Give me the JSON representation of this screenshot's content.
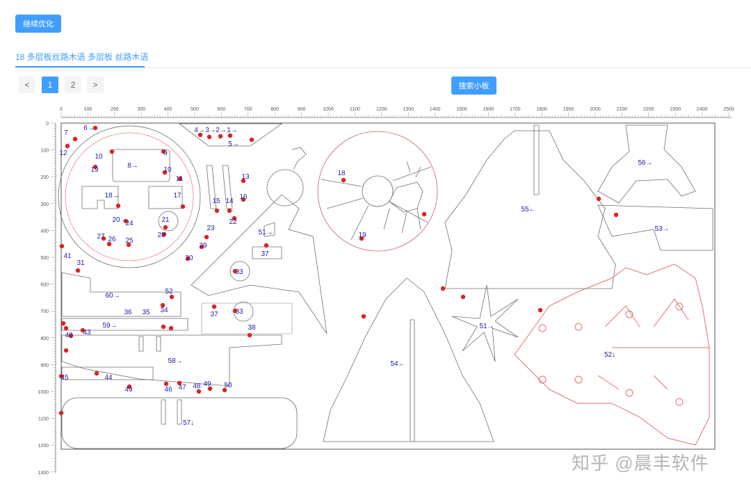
{
  "toolbar": {
    "continue_label": "继续优化",
    "search_label": "搜索小板"
  },
  "tab": {
    "title": "18 多层板丝路木语 多层板 丝路木语"
  },
  "pagination": {
    "prev": "<",
    "next": ">",
    "pages": [
      "1",
      "2"
    ],
    "current": "1"
  },
  "ruler": {
    "x_ticks": [
      "0",
      "100",
      "200",
      "300",
      "400",
      "500",
      "600",
      "700",
      "800",
      "900",
      "1000",
      "1100",
      "1200",
      "1300",
      "1400",
      "1500",
      "1600",
      "1700",
      "1800",
      "1900",
      "2000",
      "2100",
      "2200",
      "2300",
      "2400",
      "2500"
    ],
    "y_ticks": [
      "0",
      "100",
      "200",
      "300",
      "400",
      "500",
      "600",
      "700",
      "800",
      "900",
      "1000",
      "1100",
      "1200",
      "1300"
    ]
  },
  "parts": [
    {
      "label": "7",
      "x": 95,
      "y": 190
    },
    {
      "label": "6→",
      "x": 128,
      "y": 183
    },
    {
      "label": "4→",
      "x": 287,
      "y": 186
    },
    {
      "label": "3→",
      "x": 303,
      "y": 186
    },
    {
      "label": "2→",
      "x": 318,
      "y": 186
    },
    {
      "label": "1→",
      "x": 334,
      "y": 186
    },
    {
      "label": "5→",
      "x": 336,
      "y": 206
    },
    {
      "label": "12",
      "x": 91,
      "y": 219
    },
    {
      "label": "10",
      "x": 142,
      "y": 224
    },
    {
      "label": "9",
      "x": 238,
      "y": 219
    },
    {
      "label": "8→",
      "x": 191,
      "y": 237
    },
    {
      "label": "19",
      "x": 136,
      "y": 243
    },
    {
      "label": "10",
      "x": 241,
      "y": 243
    },
    {
      "label": "11",
      "x": 258,
      "y": 256
    },
    {
      "label": "13",
      "x": 353,
      "y": 253
    },
    {
      "label": "18→",
      "x": 161,
      "y": 280
    },
    {
      "label": "17",
      "x": 255,
      "y": 280
    },
    {
      "label": "16",
      "x": 350,
      "y": 282
    },
    {
      "label": "15",
      "x": 311,
      "y": 288
    },
    {
      "label": "14",
      "x": 330,
      "y": 288
    },
    {
      "label": "20→",
      "x": 172,
      "y": 315
    },
    {
      "label": "21",
      "x": 238,
      "y": 315
    },
    {
      "label": "24",
      "x": 186,
      "y": 320
    },
    {
      "label": "22",
      "x": 335,
      "y": 318
    },
    {
      "label": "23",
      "x": 303,
      "y": 327
    },
    {
      "label": "27",
      "x": 145,
      "y": 339
    },
    {
      "label": "26",
      "x": 161,
      "y": 343
    },
    {
      "label": "25",
      "x": 186,
      "y": 345
    },
    {
      "label": "28",
      "x": 232,
      "y": 337
    },
    {
      "label": "29",
      "x": 292,
      "y": 352
    },
    {
      "label": "30",
      "x": 272,
      "y": 370
    },
    {
      "label": "51→",
      "x": 382,
      "y": 333
    },
    {
      "label": "37",
      "x": 381,
      "y": 364
    },
    {
      "label": "41",
      "x": 97,
      "y": 367
    },
    {
      "label": "31",
      "x": 116,
      "y": 377
    },
    {
      "label": "33",
      "x": 344,
      "y": 390
    },
    {
      "label": "60→",
      "x": 162,
      "y": 424
    },
    {
      "label": "52",
      "x": 243,
      "y": 418
    },
    {
      "label": "36",
      "x": 184,
      "y": 448
    },
    {
      "label": "35",
      "x": 210,
      "y": 448
    },
    {
      "label": "34",
      "x": 236,
      "y": 445
    },
    {
      "label": "37",
      "x": 308,
      "y": 451
    },
    {
      "label": "33",
      "x": 344,
      "y": 447
    },
    {
      "label": "59→",
      "x": 158,
      "y": 467
    },
    {
      "label": "38",
      "x": 362,
      "y": 470
    },
    {
      "label": "40",
      "x": 99,
      "y": 481
    },
    {
      "label": "43",
      "x": 125,
      "y": 477
    },
    {
      "label": "58→",
      "x": 252,
      "y": 518
    },
    {
      "label": "45",
      "x": 93,
      "y": 542
    },
    {
      "label": "44",
      "x": 156,
      "y": 542
    },
    {
      "label": "49",
      "x": 185,
      "y": 559
    },
    {
      "label": "46",
      "x": 242,
      "y": 559
    },
    {
      "label": "47",
      "x": 262,
      "y": 556
    },
    {
      "label": "48",
      "x": 283,
      "y": 554
    },
    {
      "label": "49",
      "x": 298,
      "y": 551
    },
    {
      "label": "50",
      "x": 328,
      "y": 553
    },
    {
      "label": "57↓",
      "x": 271,
      "y": 607
    },
    {
      "label": "18",
      "x": 491,
      "y": 248
    },
    {
      "label": "19",
      "x": 521,
      "y": 337
    },
    {
      "label": "55←",
      "x": 760,
      "y": 300
    },
    {
      "label": "56→",
      "x": 928,
      "y": 233
    },
    {
      "label": "53→",
      "x": 952,
      "y": 328
    },
    {
      "label": "54←",
      "x": 572,
      "y": 522
    },
    {
      "label": "51→",
      "x": 700,
      "y": 468
    },
    {
      "label": "52↓",
      "x": 877,
      "y": 509
    }
  ],
  "watermark": "知乎 @晨丰软件"
}
